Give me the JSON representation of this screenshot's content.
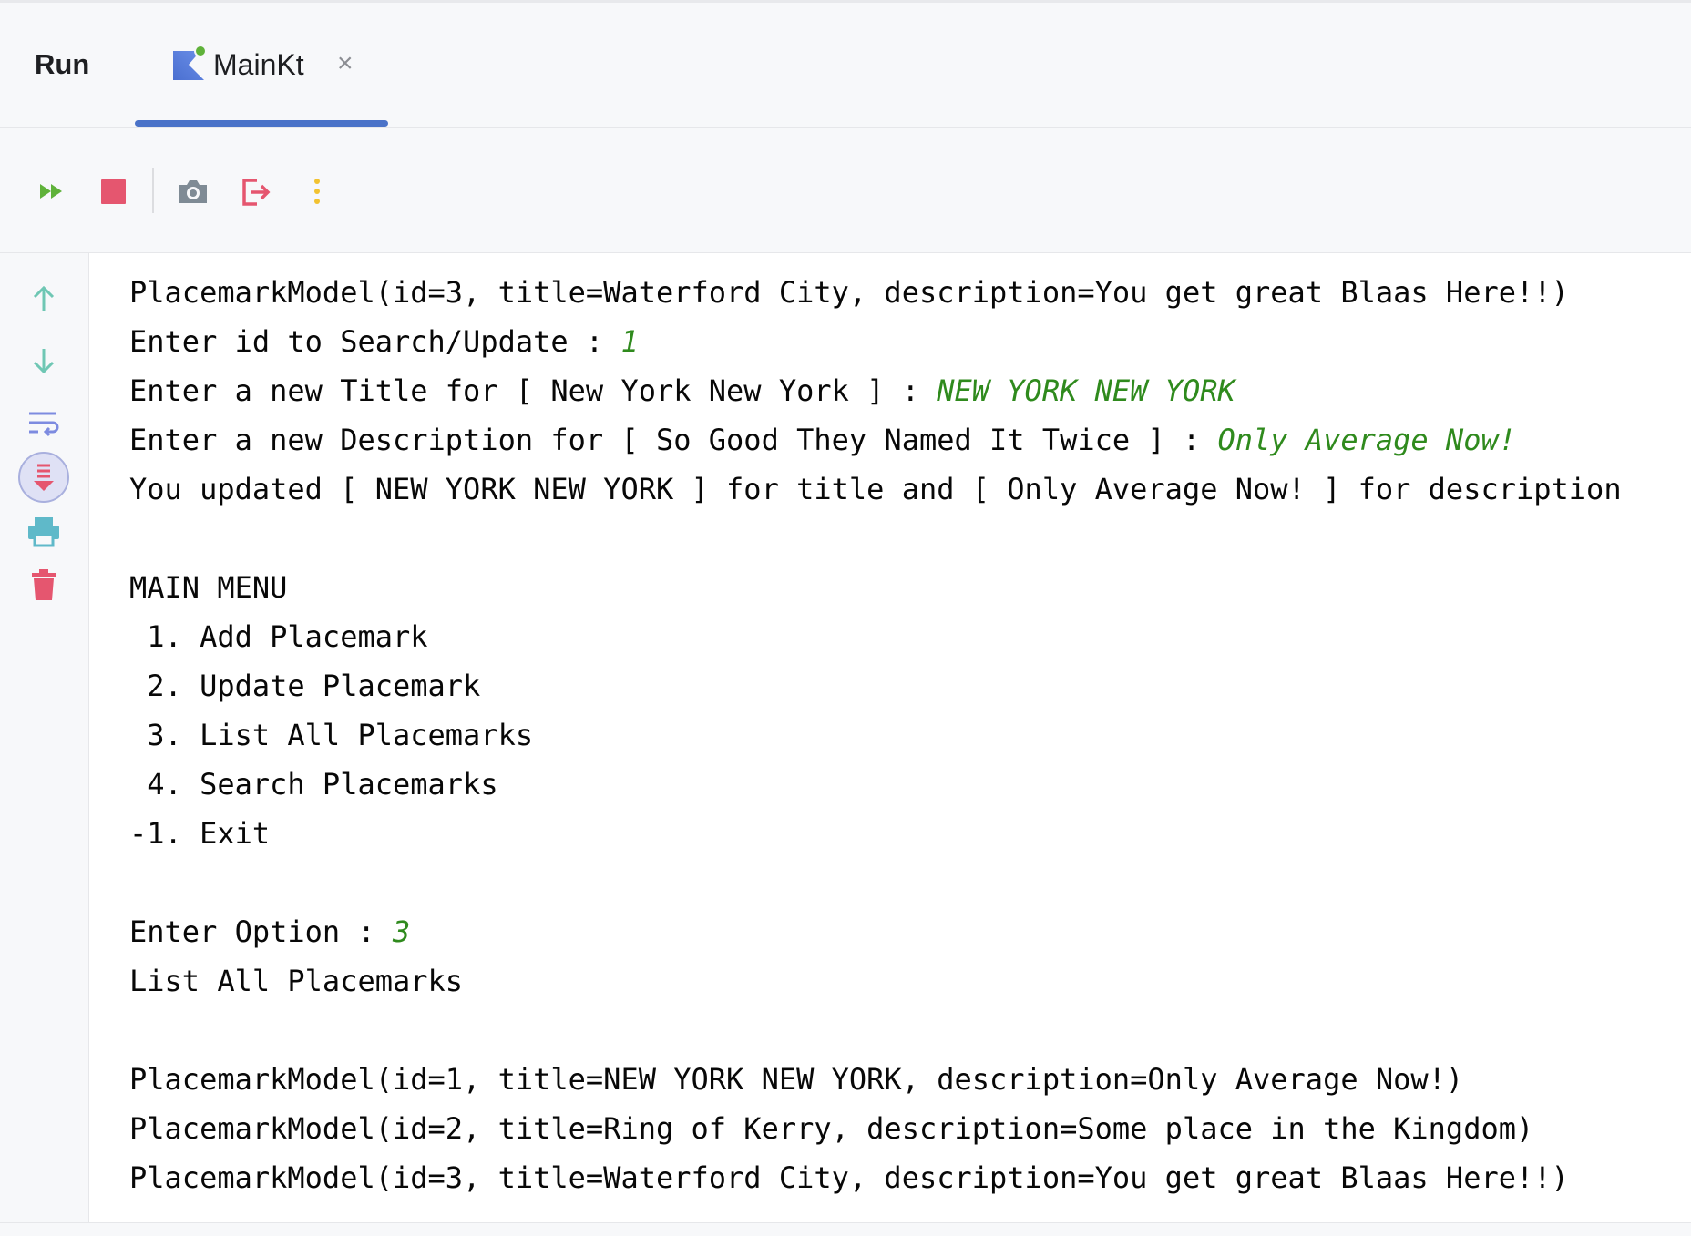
{
  "header": {
    "run_label": "Run",
    "tab": {
      "label": "MainKt",
      "icon": "kotlin-run-icon",
      "close_glyph": "×"
    }
  },
  "toolbar": {
    "buttons": [
      "rerun-icon",
      "stop-icon",
      "camera-icon",
      "exit-icon",
      "more-icon"
    ]
  },
  "gutter": {
    "buttons": [
      "arrow-up-icon",
      "arrow-down-icon",
      "soft-wrap-icon",
      "scroll-to-end-icon",
      "print-icon",
      "trash-icon"
    ]
  },
  "colors": {
    "accent": "#4a72c8",
    "user_input": "#2f8a1d",
    "stop": "#e5566f",
    "rerun": "#5fb23a",
    "more": "#f2c230",
    "gutter_icon": "#5fb9a7"
  },
  "console": {
    "lines": [
      {
        "t": "PlacemarkModel(id=3, title=Waterford City, description=You get great Blaas Here!!)",
        "in": ""
      },
      {
        "t": "Enter id to Search/Update : ",
        "in": "1"
      },
      {
        "t": "Enter a new Title for [ New York New York ] : ",
        "in": "NEW YORK NEW YORK"
      },
      {
        "t": "Enter a new Description for [ So Good They Named It Twice ] : ",
        "in": "Only Average Now!"
      },
      {
        "t": "You updated [ NEW YORK NEW YORK ] for title and [ Only Average Now! ] for description",
        "in": ""
      },
      {
        "t": "",
        "in": ""
      },
      {
        "t": "MAIN MENU",
        "in": ""
      },
      {
        "t": " 1. Add Placemark",
        "in": ""
      },
      {
        "t": " 2. Update Placemark",
        "in": ""
      },
      {
        "t": " 3. List All Placemarks",
        "in": ""
      },
      {
        "t": " 4. Search Placemarks",
        "in": ""
      },
      {
        "t": "-1. Exit",
        "in": ""
      },
      {
        "t": "",
        "in": ""
      },
      {
        "t": "Enter Option : ",
        "in": "3"
      },
      {
        "t": "List All Placemarks",
        "in": ""
      },
      {
        "t": "",
        "in": ""
      },
      {
        "t": "PlacemarkModel(id=1, title=NEW YORK NEW YORK, description=Only Average Now!)",
        "in": ""
      },
      {
        "t": "PlacemarkModel(id=2, title=Ring of Kerry, description=Some place in the Kingdom)",
        "in": ""
      },
      {
        "t": "PlacemarkModel(id=3, title=Waterford City, description=You get great Blaas Here!!)",
        "in": ""
      }
    ]
  }
}
